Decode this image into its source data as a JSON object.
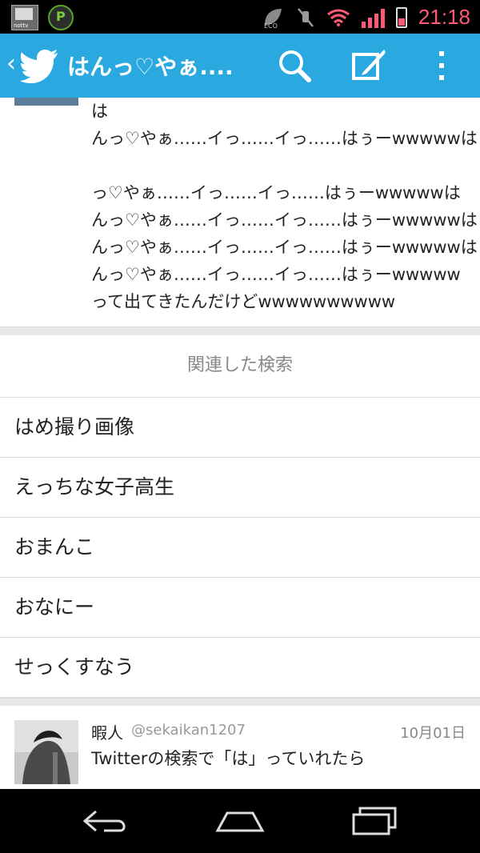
{
  "status_bar": {
    "tv_label": "nottv",
    "time": "21:18",
    "icons": [
      "tv-app-icon",
      "p-app-icon",
      "eco-icon",
      "mute-icon",
      "wifi-icon",
      "signal-icon",
      "battery-icon"
    ]
  },
  "action_bar": {
    "title": "はんっ♡やぁ....",
    "color": "#2aa9e0",
    "icons": [
      "back-chevron-icon",
      "twitter-bird-icon",
      "search-icon",
      "compose-icon",
      "overflow-menu-icon"
    ]
  },
  "tweet_text": {
    "lines": [
      "は",
      "んっ♡やぁ……イっ……イっ……はぅーwwwwwは",
      "",
      "っ♡やぁ……イっ……イっ……はぅーwwwwwは",
      "んっ♡やぁ……イっ……イっ……はぅーwwwwwは",
      "んっ♡やぁ……イっ……イっ……はぅーwwwwwは",
      "んっ♡やぁ……イっ……イっ……はぅーwwwww",
      "って出てきたんだけどwwwwwwwwww"
    ]
  },
  "related": {
    "heading": "関連した検索",
    "items": [
      "はめ撮り画像",
      "えっちな女子高生",
      "おまんこ",
      "おなにー",
      "せっくすなう"
    ]
  },
  "tweet_card": {
    "name": "暇人",
    "handle": "@sekaikan1207",
    "date": "10月01日",
    "text": "Twitterの検索で「は」っていれたら"
  },
  "nav_bar": {
    "icons": [
      "back-icon",
      "home-icon",
      "recent-apps-icon"
    ]
  }
}
